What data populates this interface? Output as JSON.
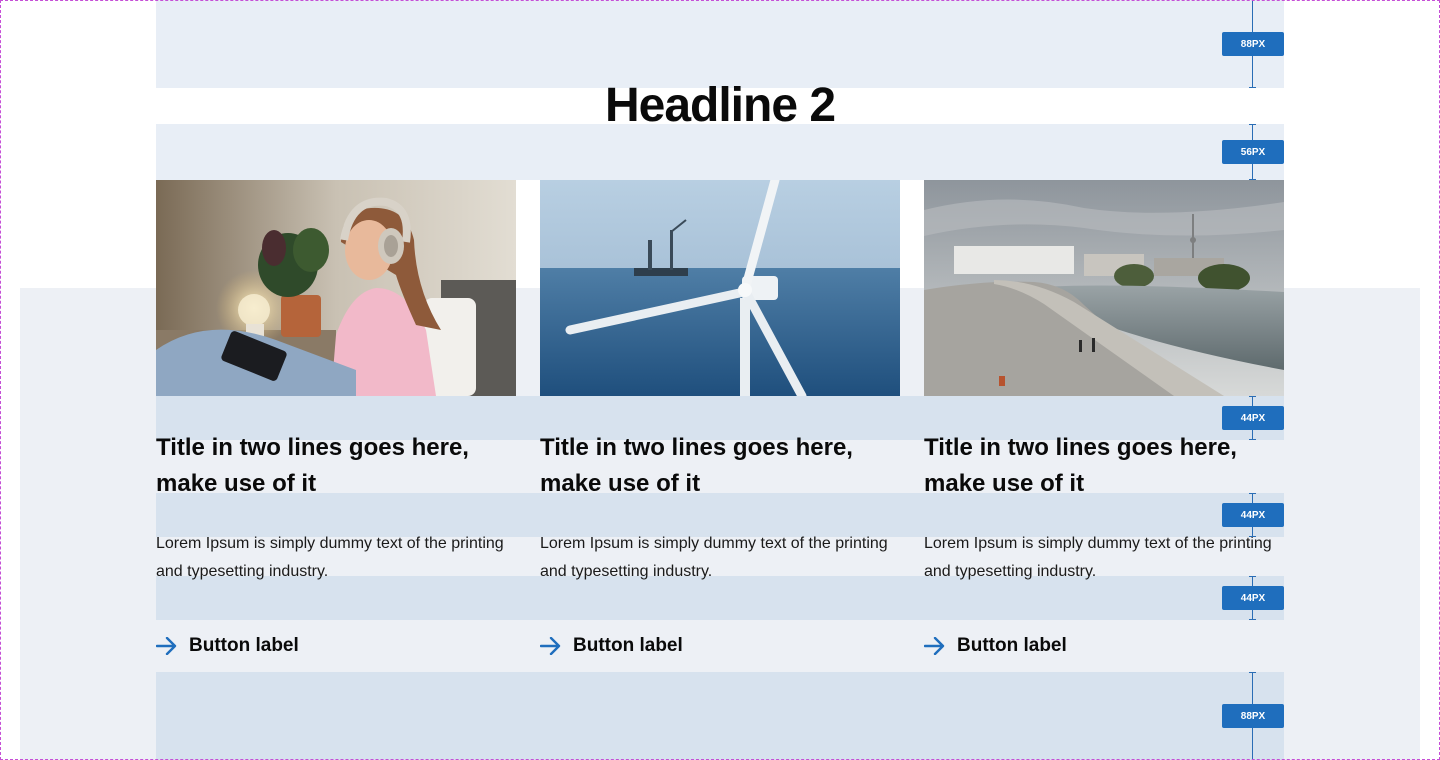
{
  "headline": "Headline 2",
  "cards": [
    {
      "title": "Title in two lines goes here, make use of it",
      "text": "Lorem Ipsum is simply dummy text of the printing and typesetting industry.",
      "button_label": "Button label",
      "image": "woman-with-headphones-photo"
    },
    {
      "title": "Title in two lines goes here, make use of it",
      "text": "Lorem Ipsum is simply dummy text of the printing and typesetting industry.",
      "button_label": "Button label",
      "image": "offshore-wind-turbine-photo"
    },
    {
      "title": "Title in two lines goes here, make use of it",
      "text": "Lorem Ipsum is simply dummy text of the printing and typesetting industry.",
      "button_label": "Button label",
      "image": "riverside-city-promenade-photo"
    }
  ],
  "spacing_labels": {
    "top": "88PX",
    "headline_gap": "56PX",
    "image_gap": "44PX",
    "title_gap": "44PX",
    "text_gap": "44PX",
    "bottom": "88PX"
  },
  "colors": {
    "accent": "#1f6ebd",
    "section_bg": "#edf0f5",
    "spacer_light": "#e8eef6",
    "spacer_mid": "#d7e2ee"
  }
}
